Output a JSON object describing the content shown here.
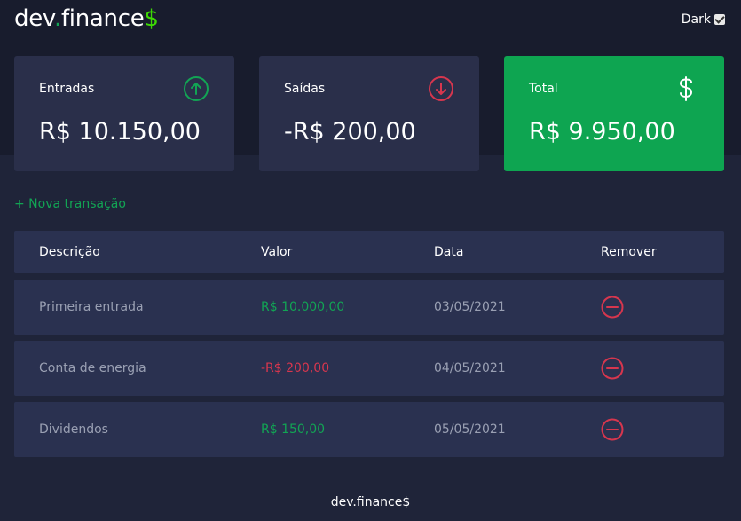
{
  "header": {
    "logo_main": "dev",
    "logo_dot": ".",
    "logo_word": "finance",
    "logo_symbol": "$",
    "theme_toggle_label": "Dark",
    "theme_toggle_checked": true
  },
  "cards": {
    "income": {
      "title": "Entradas",
      "value": "R$ 10.150,00",
      "icon": "arrow-up-circle-icon"
    },
    "expense": {
      "title": "Saídas",
      "value": "-R$ 200,00",
      "icon": "arrow-down-circle-icon"
    },
    "total": {
      "title": "Total",
      "value": "R$ 9.950,00",
      "icon": "dollar-icon"
    }
  },
  "actions": {
    "new_transaction": "+ Nova transação"
  },
  "table": {
    "headers": [
      "Descrição",
      "Valor",
      "Data",
      "Remover"
    ],
    "rows": [
      {
        "description": "Primeira entrada",
        "amount": "R$ 10.000,00",
        "date": "03/05/2021",
        "type": "income"
      },
      {
        "description": "Conta de energia",
        "amount": "-R$ 200,00",
        "date": "04/05/2021",
        "type": "expense"
      },
      {
        "description": "Dividendos",
        "amount": "R$ 150,00",
        "date": "05/05/2021",
        "type": "income"
      }
    ]
  },
  "footer": {
    "text": "dev.finance$"
  },
  "colors": {
    "background": "#1f2439",
    "header": "#181c2d",
    "card": "#2a2f4a",
    "total_card": "#0ea551",
    "income": "#12a454",
    "expense": "#d7364e"
  }
}
